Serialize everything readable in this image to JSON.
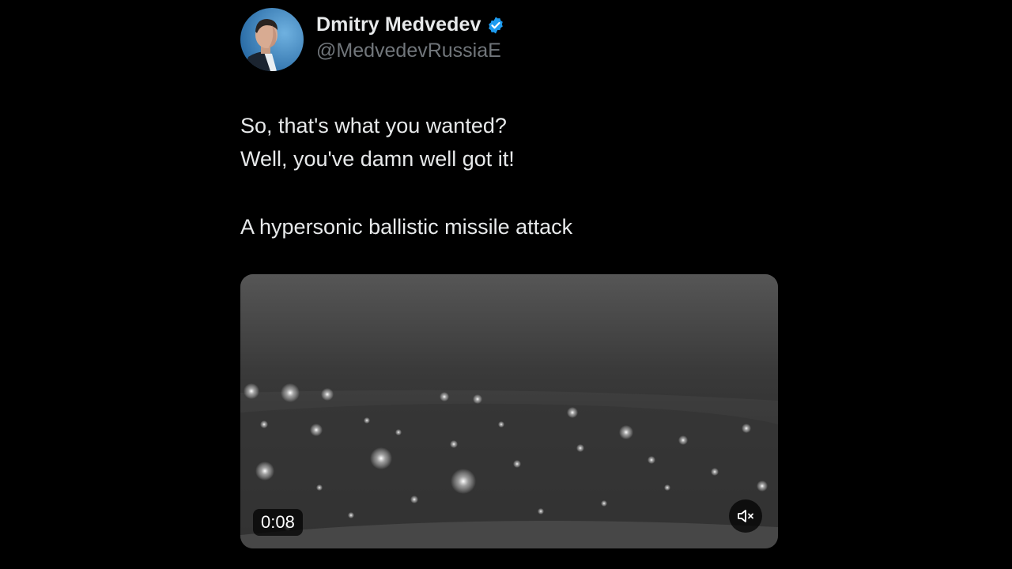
{
  "tweet": {
    "author": {
      "display_name": "Dmitry Medvedev",
      "handle": "@MedvedevRussiaE",
      "verified": true,
      "avatar_icon": "user-portrait-avatar"
    },
    "text_lines": [
      "So, that's what you wanted?",
      "Well, you've damn well got it!",
      "",
      "A hypersonic ballistic missile attack"
    ],
    "media": {
      "type": "video",
      "timestamp": "0:08",
      "muted": true,
      "mute_icon": "speaker-muted-icon"
    }
  },
  "colors": {
    "background": "#000000",
    "primary_text": "#e7e9ea",
    "secondary_text": "#71767b",
    "verified_badge": "#1d9bf0"
  }
}
